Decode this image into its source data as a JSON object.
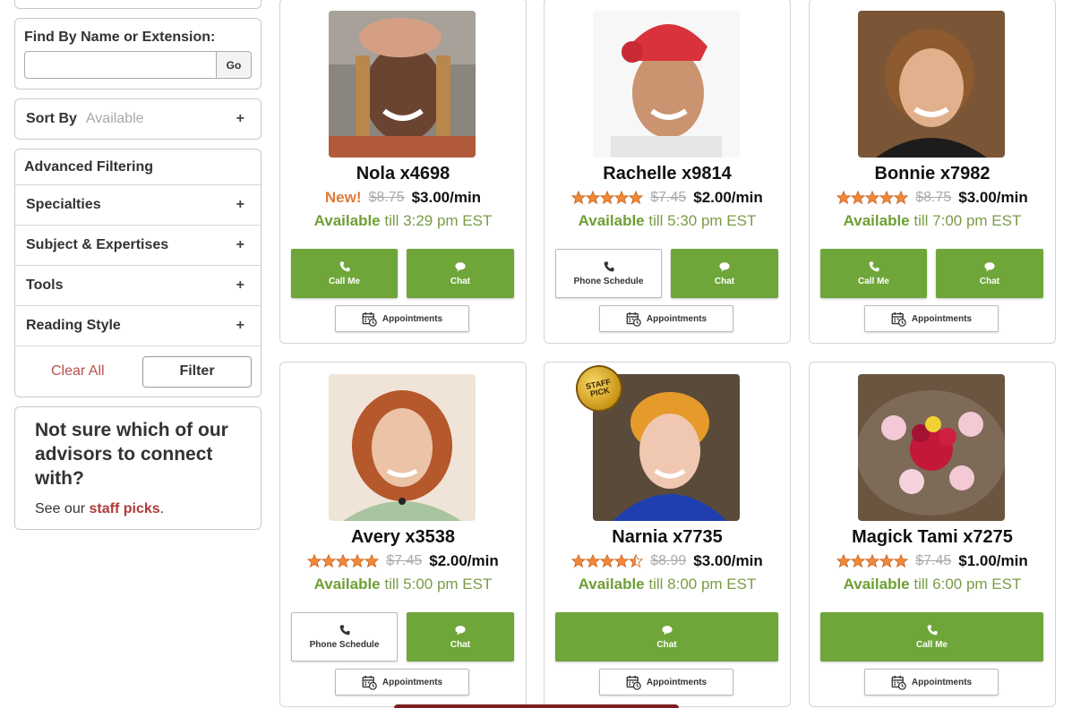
{
  "sidebar": {
    "find_label": "Find By Name or Extension:",
    "find_value": "",
    "go_label": "Go",
    "sort_label": "Sort By",
    "sort_value": "Available",
    "advanced_title": "Advanced Filtering",
    "filters": [
      "Specialties",
      "Subject & Expertises",
      "Tools",
      "Reading Style"
    ],
    "clear_all": "Clear All",
    "filter_label": "Filter",
    "notsure_heading": "Not sure which of our advisors to connect with?",
    "notsure_prefix": "See our",
    "notsure_link": "staff picks",
    "notsure_suffix": "."
  },
  "common": {
    "available_word": "Available",
    "appointments_label": "Appointments",
    "staff_pick_label": "STAFF PICK"
  },
  "advisors": [
    {
      "name": "Nola x4698",
      "new_label": "New!",
      "old_price": "$8.75",
      "price": "$3.00/min",
      "until": "till 3:29 pm EST",
      "buttons": [
        "Call Me",
        "Chat"
      ]
    },
    {
      "name": "Rachelle x9814",
      "old_price": "$7.45",
      "price": "$2.00/min",
      "until": "till 5:30 pm EST",
      "rating": 5,
      "buttons": [
        "Phone Schedule",
        "Chat"
      ]
    },
    {
      "name": "Bonnie x7982",
      "old_price": "$8.75",
      "price": "$3.00/min",
      "until": "till 7:00 pm EST",
      "rating": 5,
      "buttons": [
        "Call Me",
        "Chat"
      ]
    },
    {
      "name": "Avery x3538",
      "old_price": "$7.45",
      "price": "$2.00/min",
      "until": "till 5:00 pm EST",
      "rating": 5,
      "buttons": [
        "Phone Schedule",
        "Chat"
      ]
    },
    {
      "name": "Narnia x7735",
      "old_price": "$8.99",
      "price": "$3.00/min",
      "until": "till 8:00 pm EST",
      "rating": 4.5,
      "staff_pick": true,
      "buttons": [
        "Chat"
      ]
    },
    {
      "name": "Magick Tami x7275",
      "old_price": "$7.45",
      "price": "$1.00/min",
      "until": "till 6:00 pm EST",
      "rating": 5,
      "buttons": [
        "Call Me"
      ]
    }
  ],
  "colors": {
    "green": "#6fa63a",
    "star": "#f0883a",
    "brand_red": "#b03a3a",
    "new_orange": "#e07a3a"
  },
  "icons": {
    "call": "phone-icon",
    "chat": "chat-bubble-icon",
    "schedule": "calendar-clock-icon"
  }
}
